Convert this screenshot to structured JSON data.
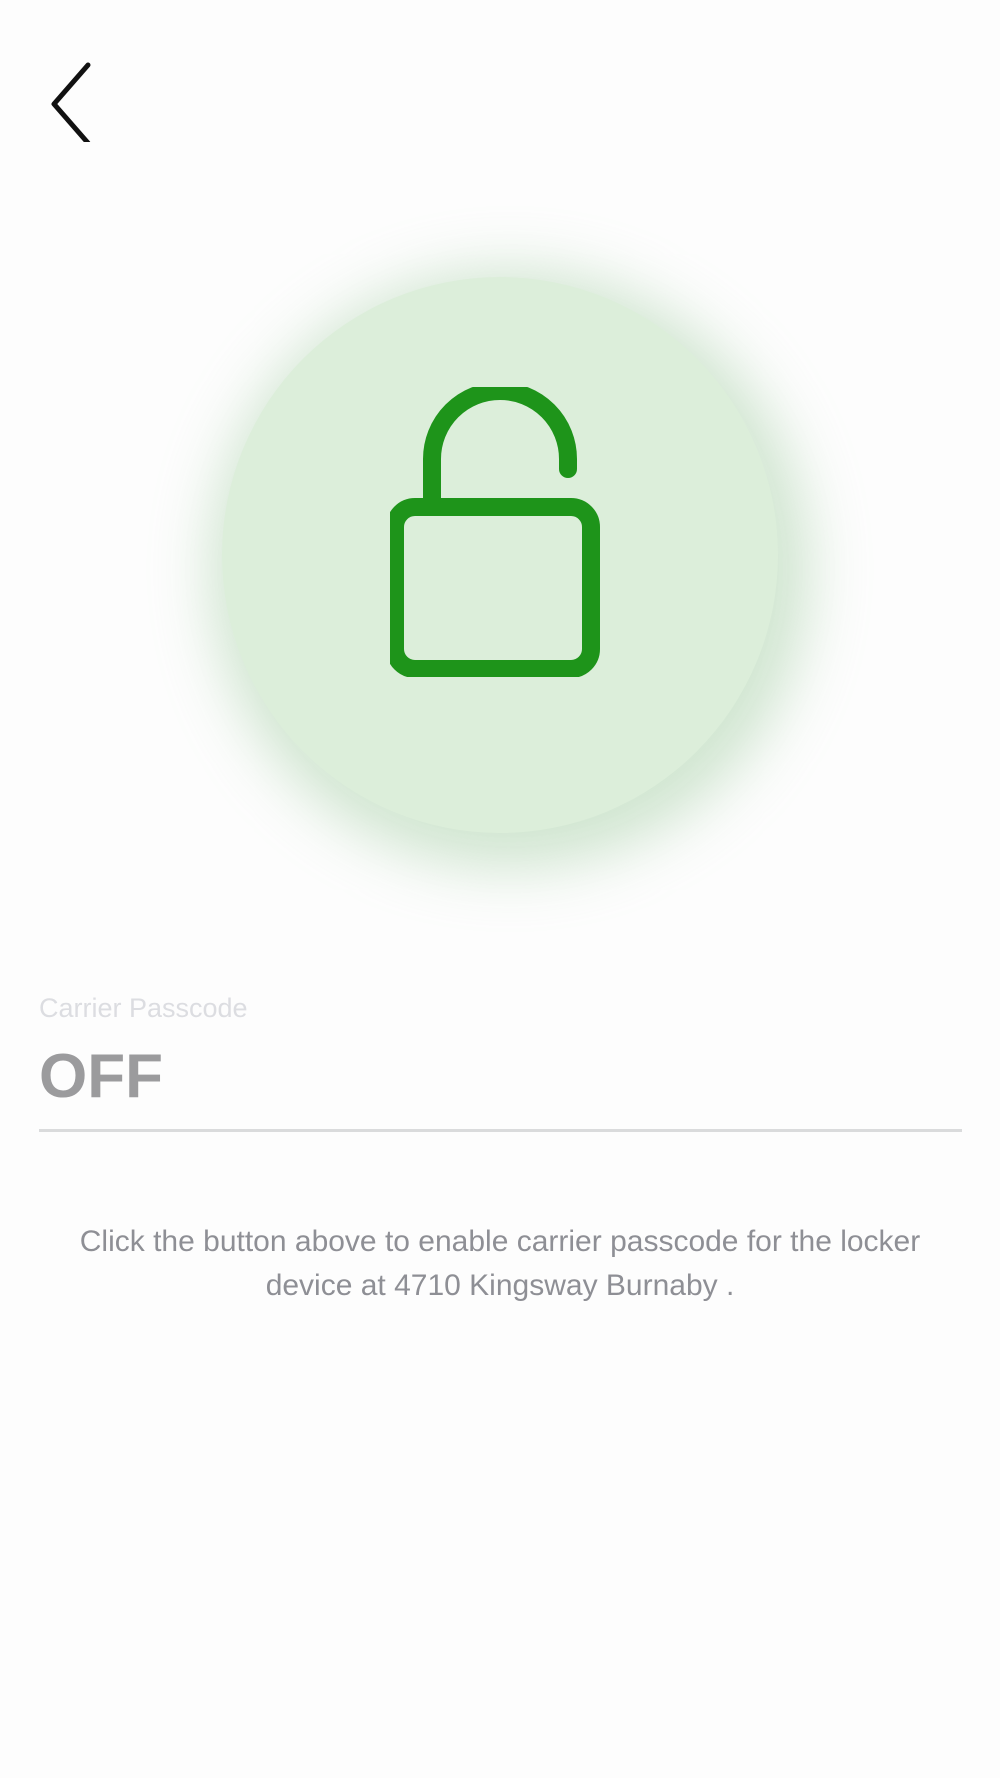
{
  "nav": {
    "back_icon": "chevron-left-icon"
  },
  "status": {
    "icon": "unlocked-padlock-icon",
    "accent_color": "#1e941a",
    "circle_color": "#dceeda"
  },
  "passcode_field": {
    "label": "Carrier Passcode",
    "value": "OFF"
  },
  "helper_text": "Click the button above to enable carrier passcode for the locker device at 4710 Kingsway Burnaby ."
}
